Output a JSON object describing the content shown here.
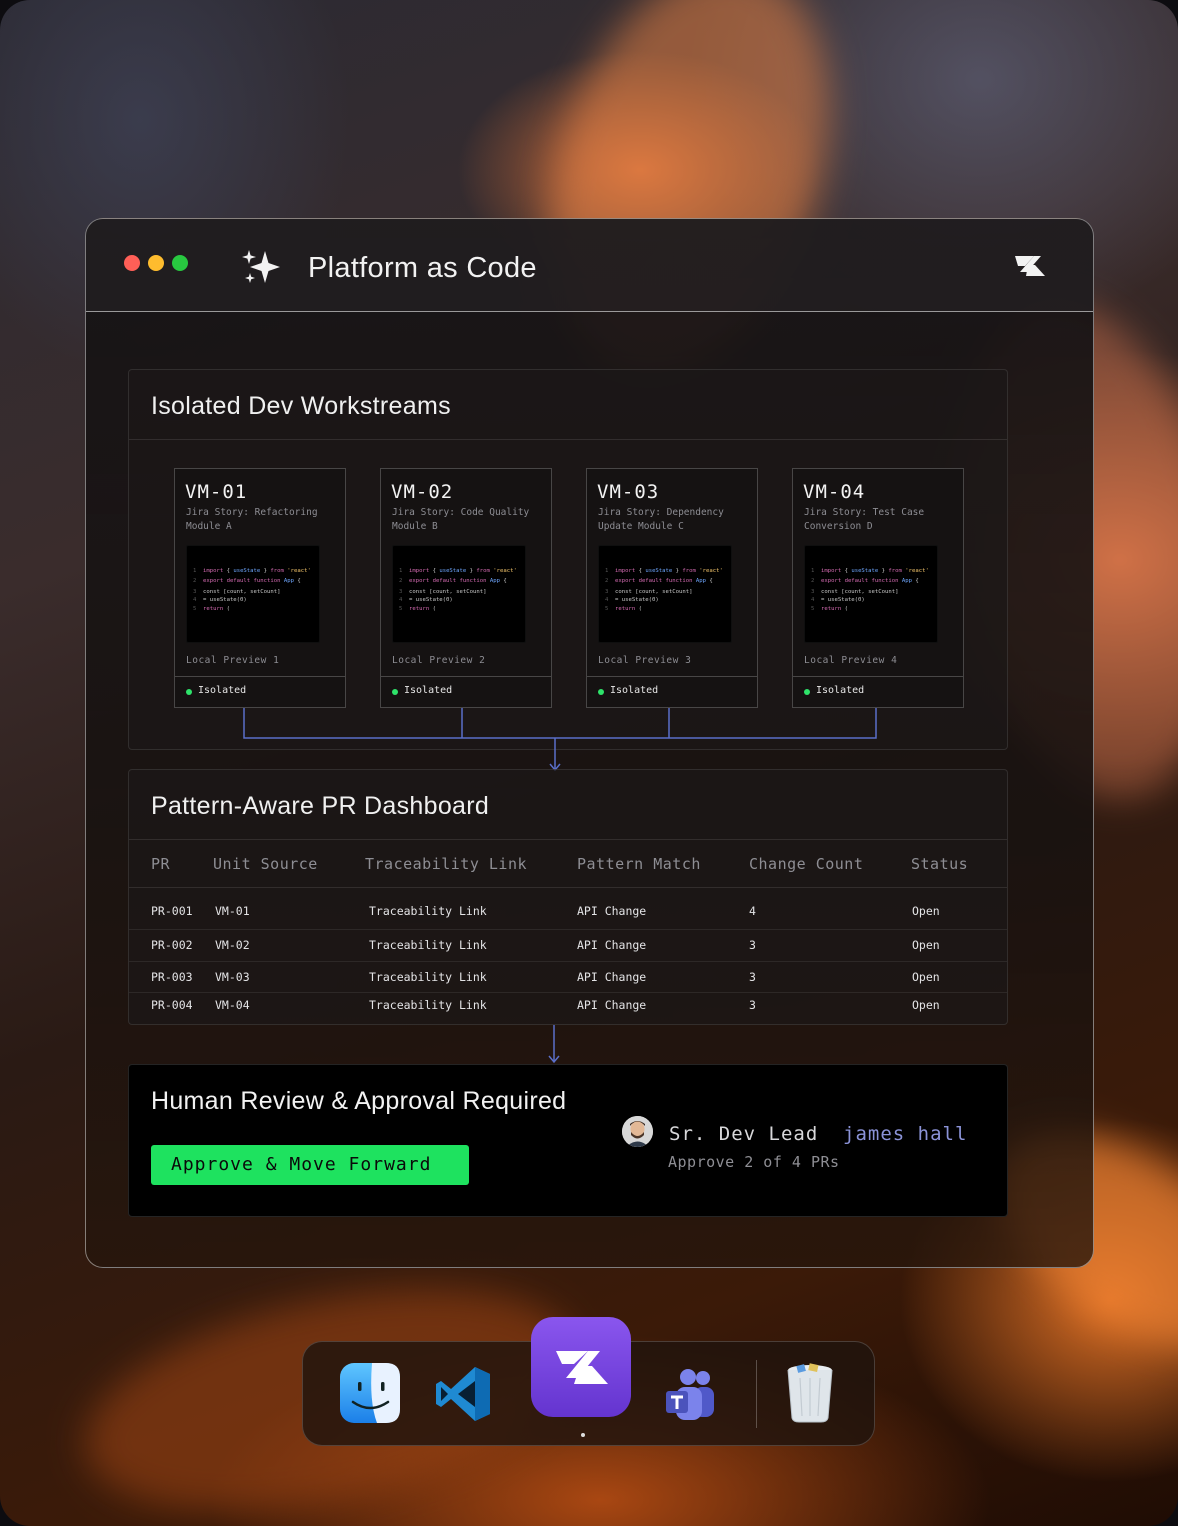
{
  "window": {
    "title": "Platform as Code",
    "traffic_lights": [
      "#ff5f57",
      "#febc2e",
      "#28c840"
    ],
    "title_icon": "sparkle-icon",
    "brand_icon": "brand-logo-icon"
  },
  "workstreams": {
    "title": "Isolated Dev Workstreams",
    "vms": [
      {
        "id": "VM-01",
        "story": "Jira Story: Refactoring Module A",
        "preview": "Local Preview 1",
        "status": "Isolated"
      },
      {
        "id": "VM-02",
        "story": "Jira Story: Code Quality Module B",
        "preview": "Local Preview 2",
        "status": "Isolated"
      },
      {
        "id": "VM-03",
        "story": "Jira Story: Dependency Update Module C",
        "preview": "Local Preview 3",
        "status": "Isolated"
      },
      {
        "id": "VM-04",
        "story": "Jira Story: Test Case Conversion D",
        "preview": "Local Preview 4",
        "status": "Isolated"
      }
    ],
    "status_color": "#2ee36a"
  },
  "dashboard": {
    "title": "Pattern-Aware PR Dashboard",
    "columns": [
      "PR",
      "Unit Source",
      "Traceability Link",
      "Pattern Match",
      "Change Count",
      "Status"
    ],
    "rows": [
      {
        "pr": "PR-001",
        "source": "VM-01",
        "link": "Traceability Link",
        "pattern": "API Change",
        "count": "4",
        "status": "Open"
      },
      {
        "pr": "PR-002",
        "source": "VM-02",
        "link": "Traceability Link",
        "pattern": "API Change",
        "count": "3",
        "status": "Open"
      },
      {
        "pr": "PR-003",
        "source": "VM-03",
        "link": "Traceability Link",
        "pattern": "API Change",
        "count": "3",
        "status": "Open"
      },
      {
        "pr": "PR-004",
        "source": "VM-04",
        "link": "Traceability Link",
        "pattern": "API Change",
        "count": "3",
        "status": "Open"
      }
    ]
  },
  "review": {
    "title": "Human Review & Approval Required",
    "button_label": "Approve & Move Forward",
    "button_color": "#1ee25f",
    "reviewer_role": "Sr. Dev Lead",
    "reviewer_name": "james hall",
    "approve_summary": "Approve 2 of 4 PRs"
  },
  "dock": {
    "items": [
      "finder-icon",
      "vscode-icon",
      "platform-app-icon",
      "teams-icon",
      "trash-icon"
    ],
    "active": "platform-app-icon"
  }
}
